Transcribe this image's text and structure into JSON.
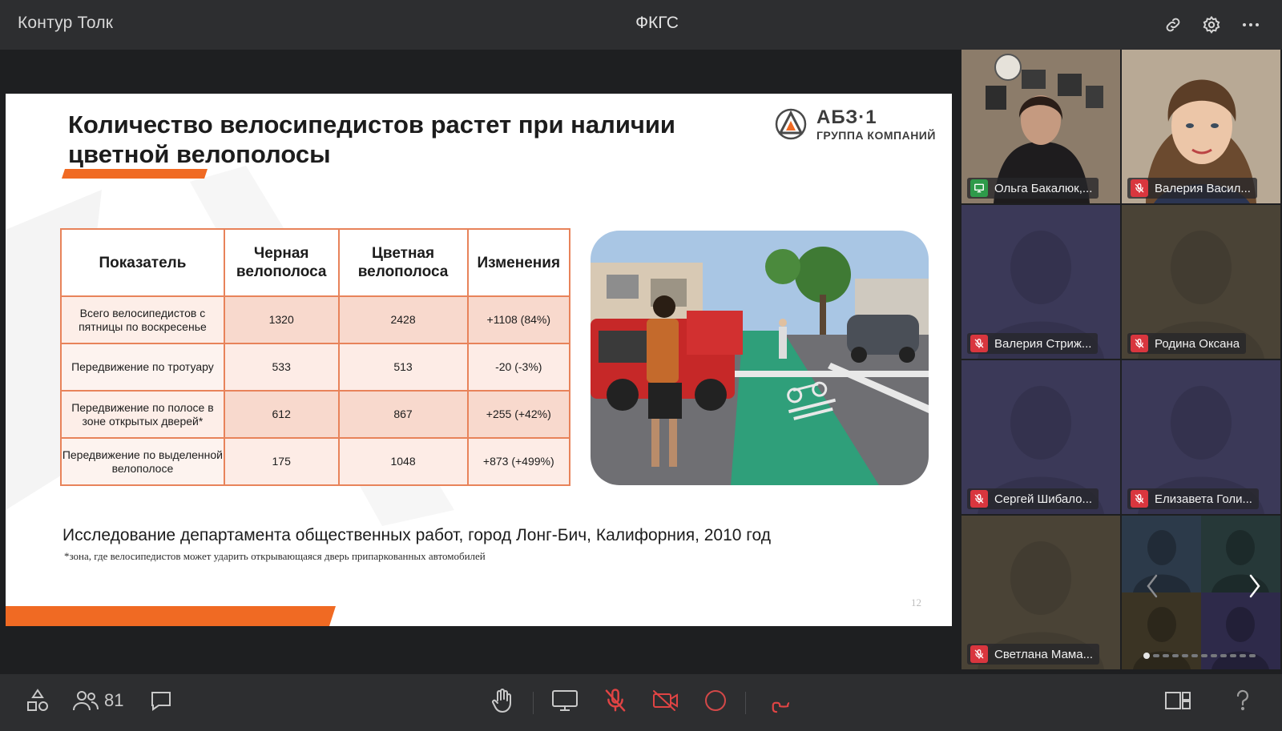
{
  "app": {
    "title": "Контур Толк",
    "meeting_title": "ФКГС"
  },
  "topbar": {
    "icons": [
      "link-icon",
      "gear-icon",
      "more-icon"
    ]
  },
  "slide": {
    "title": "Количество велосипедистов растет при наличии цветной велополосы",
    "logo": {
      "name": "АБЗ·1",
      "subtitle": "ГРУППА КОМПАНИЙ"
    },
    "table": {
      "headers": [
        "Показатель",
        "Черная велополоса",
        "Цветная велополоса",
        "Изменения"
      ],
      "rows": [
        [
          "Всего велосипедистов с пятницы по воскресенье",
          "1320",
          "2428",
          "+1108 (84%)"
        ],
        [
          "Передвижение по тротуару",
          "533",
          "513",
          "-20 (-3%)"
        ],
        [
          "Передвижение по полосе в зоне открытых дверей*",
          "612",
          "867",
          "+255 (+42%)"
        ],
        [
          "Передвижение по выделенной велополосе",
          "175",
          "1048",
          "+873 (+499%)"
        ]
      ]
    },
    "caption": "Исследование департамента общественных работ, город Лонг-Бич, Калифорния, 2010 год",
    "footnote": "*зона, где велосипедистов может ударить открывающаяся дверь припаркованных автомобилей",
    "page_number": "12",
    "colors": {
      "accent": "#f06a23",
      "table_border": "#e8835a",
      "lane_green": "#2f9f7a"
    }
  },
  "participants": [
    {
      "name": "Ольга Бакалюк,...",
      "status": "sharing-screen",
      "video": true,
      "active": true
    },
    {
      "name": "Валерия Васил...",
      "status": "muted",
      "video": true,
      "active": false
    },
    {
      "name": "Валерия Стриж...",
      "status": "muted",
      "video": false,
      "bg": "#3b3958"
    },
    {
      "name": "Родина Оксана",
      "status": "muted",
      "video": false,
      "bg": "#4a4336"
    },
    {
      "name": "Сергей Шибало...",
      "status": "muted",
      "video": false,
      "bg": "#3b3958"
    },
    {
      "name": "Елизавета Голи...",
      "status": "muted",
      "video": false,
      "bg": "#3b3958"
    },
    {
      "name": "Светлана Мама...",
      "status": "muted",
      "video": false,
      "bg": "#4a4336"
    }
  ],
  "grid_pagination": {
    "pages": 12,
    "current": 1
  },
  "toolbar": {
    "participants_count": "81",
    "icons": [
      "shapes-icon",
      "people-icon",
      "chat-icon",
      "raise-hand-icon",
      "screen-share-icon",
      "mic-off-icon",
      "camera-off-icon",
      "record-icon",
      "hang-up-icon",
      "layout-icon",
      "help-icon"
    ]
  }
}
